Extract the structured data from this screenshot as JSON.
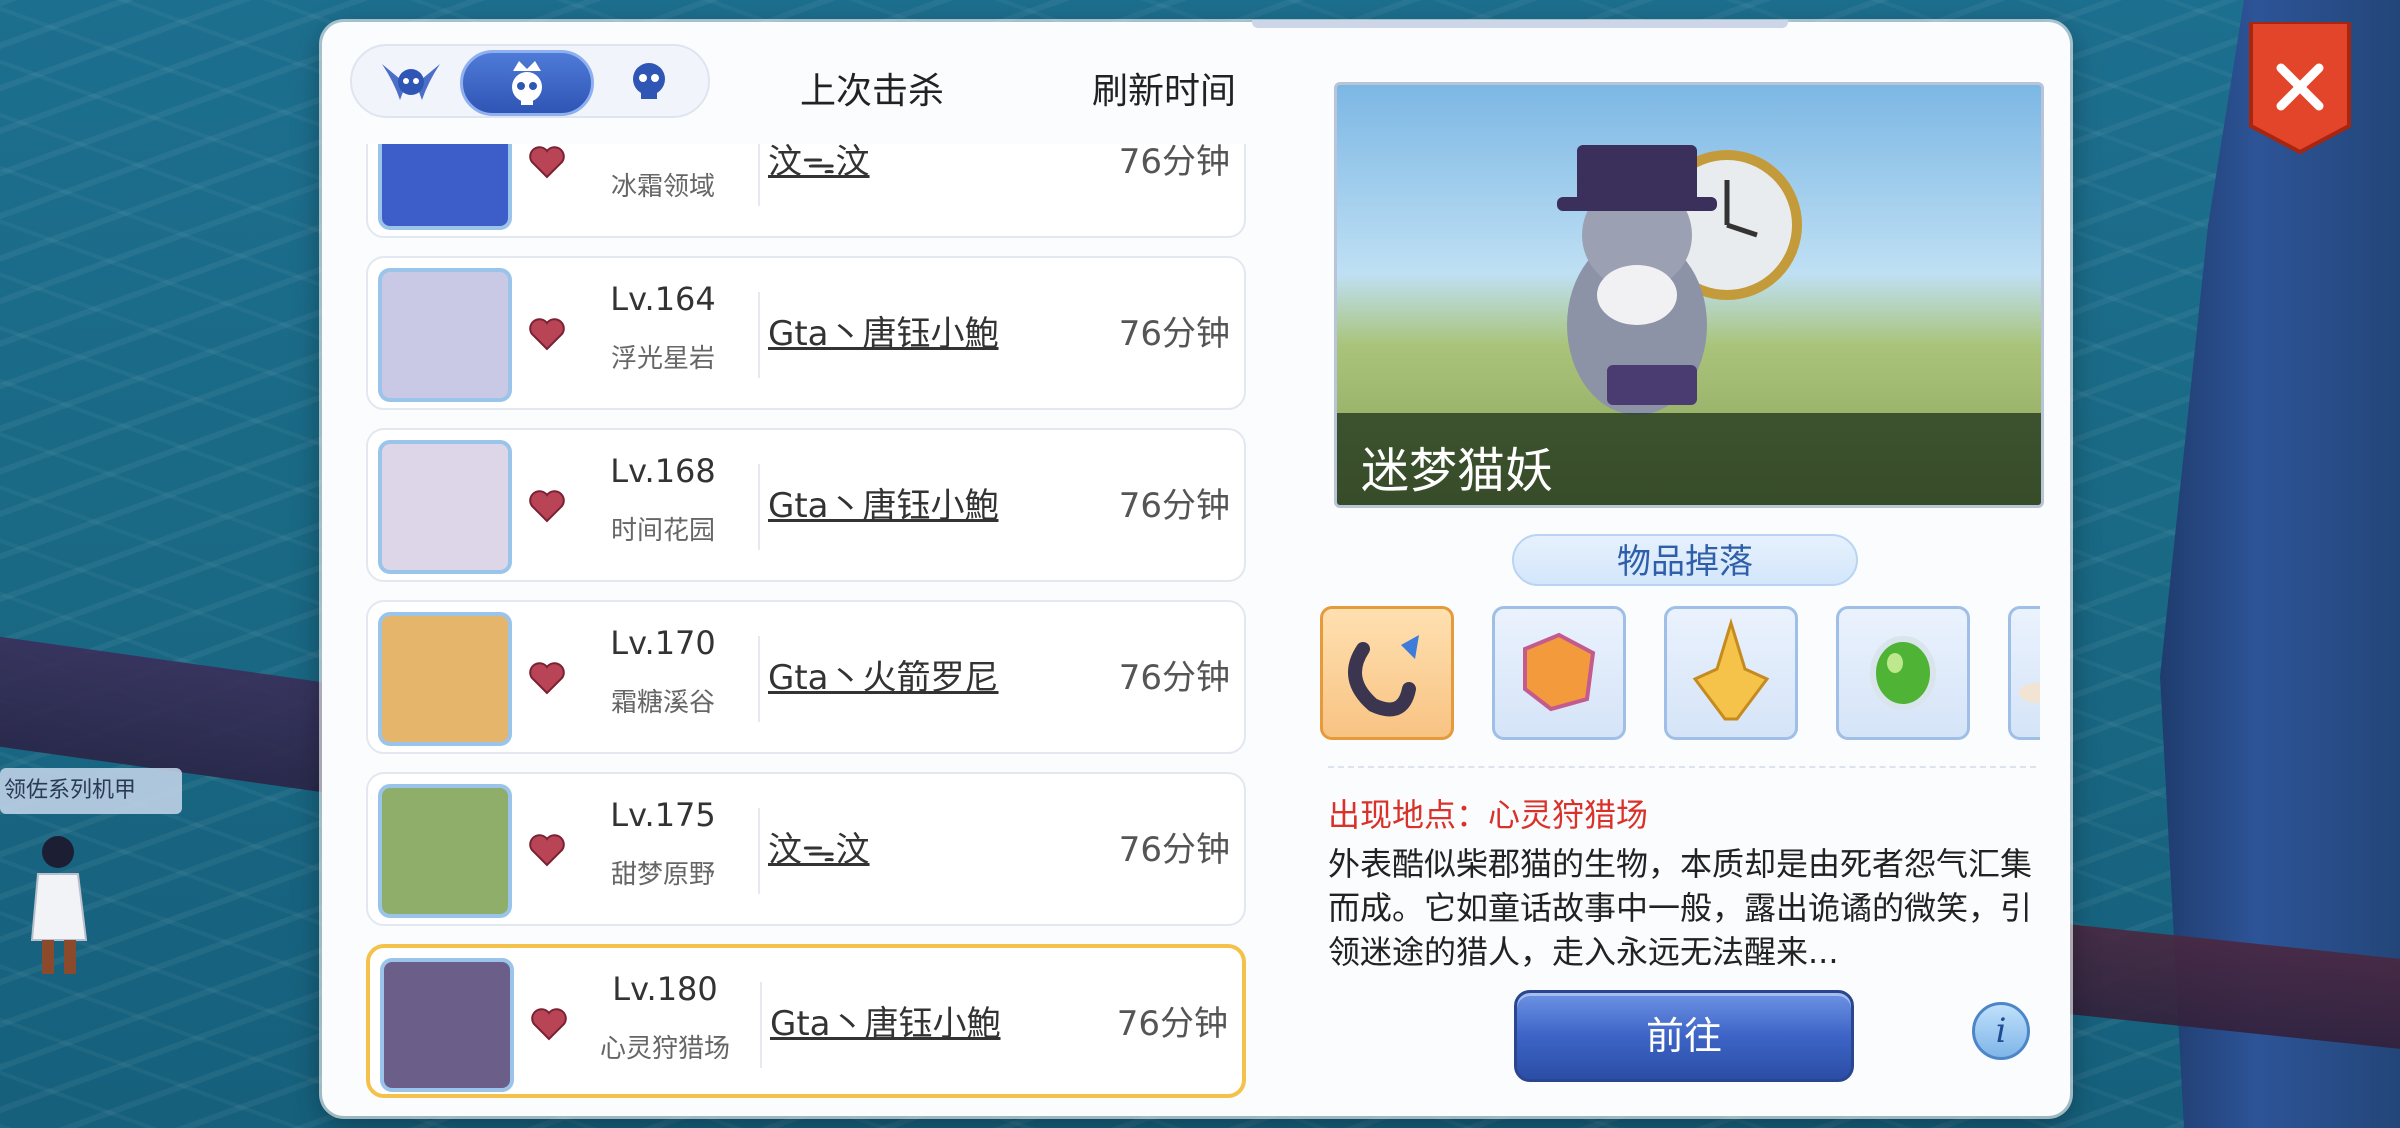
{
  "tabs": [
    "boss-tab-winged",
    "boss-tab-crowned",
    "boss-tab-skull"
  ],
  "headers": {
    "last_kill": "上次击杀",
    "refresh_time": "刷新时间"
  },
  "rows": [
    {
      "level": "",
      "map": "冰霜领域",
      "killer": "汶ᯓ汶",
      "time": "76分钟",
      "avatar_color": "#3d5ec8"
    },
    {
      "level": "Lv.164",
      "map": "浮光星岩",
      "killer": "Gta丶唐钰小鮑",
      "time": "76分钟",
      "avatar_color": "#c9c9e6"
    },
    {
      "level": "Lv.168",
      "map": "时间花园",
      "killer": "Gta丶唐钰小鮑",
      "time": "76分钟",
      "avatar_color": "#dcd6e8"
    },
    {
      "level": "Lv.170",
      "map": "霜糖溪谷",
      "killer": "Gta丶火箭罗尼",
      "time": "76分钟",
      "avatar_color": "#e4b56a"
    },
    {
      "level": "Lv.175",
      "map": "甜梦原野",
      "killer": "汶ᯓ汶",
      "time": "76分钟",
      "avatar_color": "#8fae6a"
    },
    {
      "level": "Lv.180",
      "map": "心灵狩猎场",
      "killer": "Gta丶唐钰小鮑",
      "time": "76分钟",
      "avatar_color": "#6b5f8a"
    }
  ],
  "boss": {
    "name": "迷梦猫妖",
    "drops_title": "物品掉落",
    "location": "出现地点：心灵狩猎场",
    "description": "外表酷似柴郡猫的生物，本质却是由死者怨气汇集而成。它如童话故事中一般，露出诡谲的微笑，引领迷途的猎人，走入永远无法醒来..."
  },
  "drops": [
    "cat-tail-card",
    "orange-fragment",
    "gold-crystal",
    "green-gem",
    "partial-item"
  ],
  "buttons": {
    "go": "前往",
    "info": "i"
  },
  "background": {
    "npc_tag": "领佐系列机甲"
  }
}
